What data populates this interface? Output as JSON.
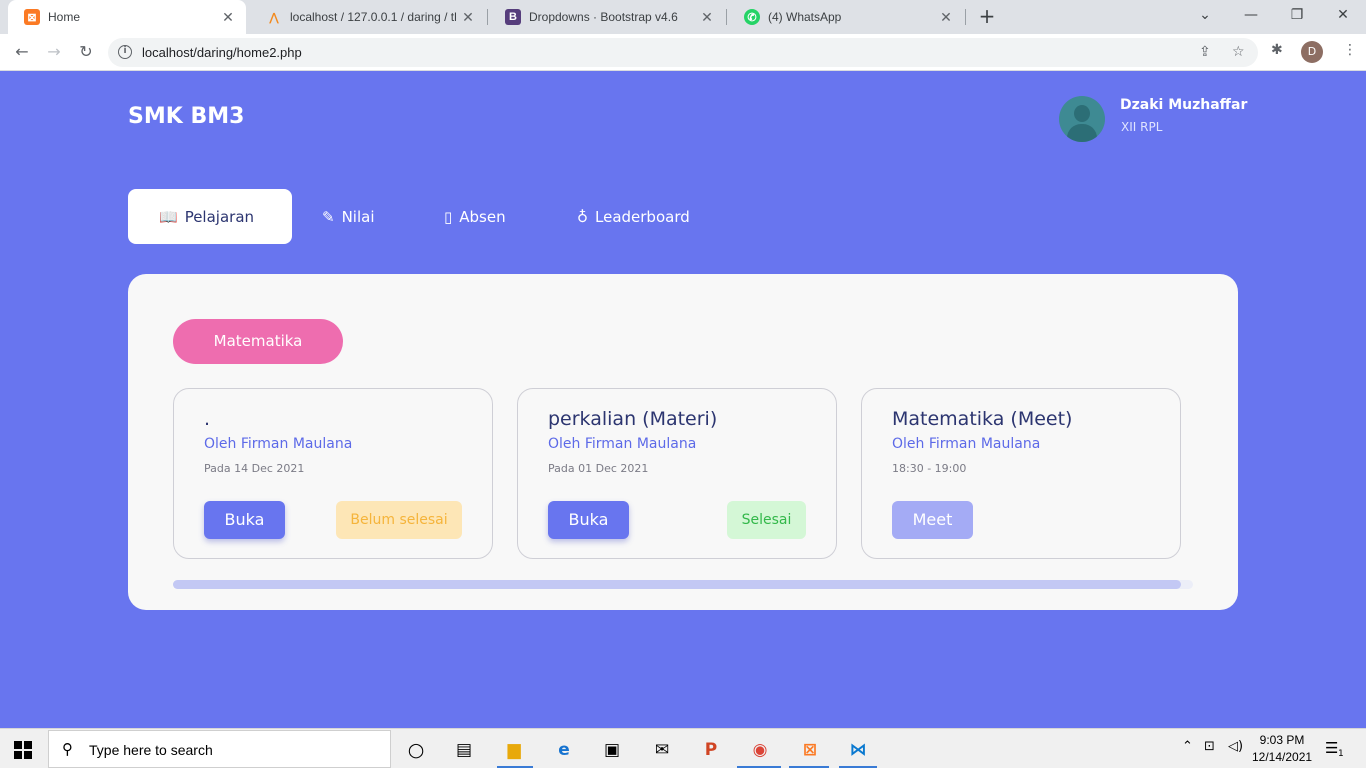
{
  "browser": {
    "tabs": [
      {
        "title": "Home",
        "favicon": "xampp-icon",
        "active": true
      },
      {
        "title": "localhost / 127.0.0.1 / daring / tb",
        "favicon": "phpmyadmin-icon"
      },
      {
        "title": "Dropdowns · Bootstrap v4.6",
        "favicon": "bootstrap-icon"
      },
      {
        "title": "(4) WhatsApp",
        "favicon": "whatsapp-icon"
      }
    ],
    "url": "localhost/daring/home2.php",
    "profile_initial": "D"
  },
  "header": {
    "brand": "SMK BM3",
    "user_name": "Dzaki Muzhaffar",
    "user_class": "XII RPL"
  },
  "menu": [
    {
      "label": "Pelajaran",
      "icon": "book-open-icon",
      "active": true
    },
    {
      "label": "Nilai",
      "icon": "chart-edit-icon"
    },
    {
      "label": "Absen",
      "icon": "clipboard-icon"
    },
    {
      "label": "Leaderboard",
      "icon": "medal-icon"
    }
  ],
  "subject": {
    "name": "Matematika"
  },
  "cards": [
    {
      "title": ".",
      "author": "Oleh Firman Maulana",
      "date": "Pada 14 Dec 2021",
      "button": "Buka",
      "status": "Belum selesai"
    },
    {
      "title": "perkalian (Materi)",
      "author": "Oleh Firman Maulana",
      "date": "Pada 01 Dec 2021",
      "button": "Buka",
      "status": "Selesai"
    },
    {
      "title": "Matematika (Meet)",
      "author": "Oleh Firman Maulana",
      "date": "18:30 - 19:00",
      "button": "Meet"
    }
  ],
  "taskbar": {
    "search_placeholder": "Type here to search",
    "time": "9:03 PM",
    "date": "12/14/2021",
    "notification_count": "1"
  },
  "colors": {
    "page_bg": "#6875ef",
    "accent_pink": "#ee6daf",
    "status_warning": "#f5b43b",
    "status_success": "#33b84a"
  }
}
